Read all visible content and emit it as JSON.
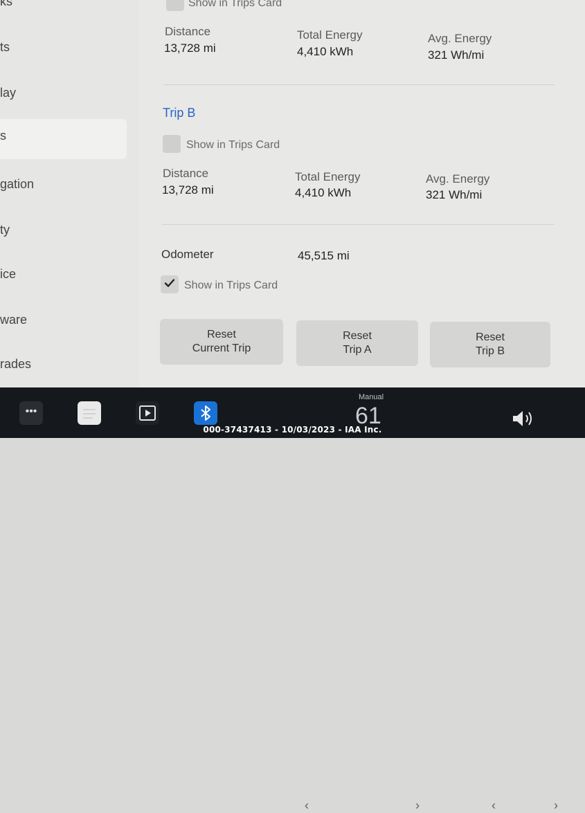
{
  "sidebar": {
    "items": [
      {
        "label": "ks"
      },
      {
        "label": "ts"
      },
      {
        "label": "lay"
      },
      {
        "label": "s"
      },
      {
        "label": "gation"
      },
      {
        "label": "ty"
      },
      {
        "label": "ice"
      },
      {
        "label": "ware"
      },
      {
        "label": "rades"
      }
    ]
  },
  "trip_a": {
    "show_in_trips_card_label": "Show in Trips Card",
    "distance_label": "Distance",
    "distance_value": "13,728  mi",
    "total_energy_label": "Total Energy",
    "total_energy_value": "4,410  kWh",
    "avg_energy_label": "Avg. Energy",
    "avg_energy_value": "321  Wh/mi"
  },
  "trip_b": {
    "title": "Trip B",
    "show_in_trips_card_label": "Show in Trips Card",
    "distance_label": "Distance",
    "distance_value": "13,728  mi",
    "total_energy_label": "Total Energy",
    "total_energy_value": "4,410  kWh",
    "avg_energy_label": "Avg. Energy",
    "avg_energy_value": "321  Wh/mi"
  },
  "odometer": {
    "label": "Odometer",
    "value": "45,515  mi",
    "show_in_trips_card_label": "Show in Trips Card",
    "show_in_trips_card_checked": true
  },
  "buttons": {
    "reset_current_line1": "Reset",
    "reset_current_line2": "Current Trip",
    "reset_a_line1": "Reset",
    "reset_a_line2": "Trip A",
    "reset_b_line1": "Reset",
    "reset_b_line2": "Trip B"
  },
  "taskbar": {
    "dots": "•••",
    "climate_mode": "Manual",
    "temperature": "61",
    "left_chevron": "‹",
    "right_chevron": "›",
    "vol_left_chevron": "‹",
    "vol_right_chevron": "›"
  },
  "watermark": "000-37437413 - 10/03/2023 - IAA Inc.",
  "colors": {
    "accent": "#2b63c9",
    "bluetooth": "#1a72d6",
    "taskbar": "#15181c"
  }
}
